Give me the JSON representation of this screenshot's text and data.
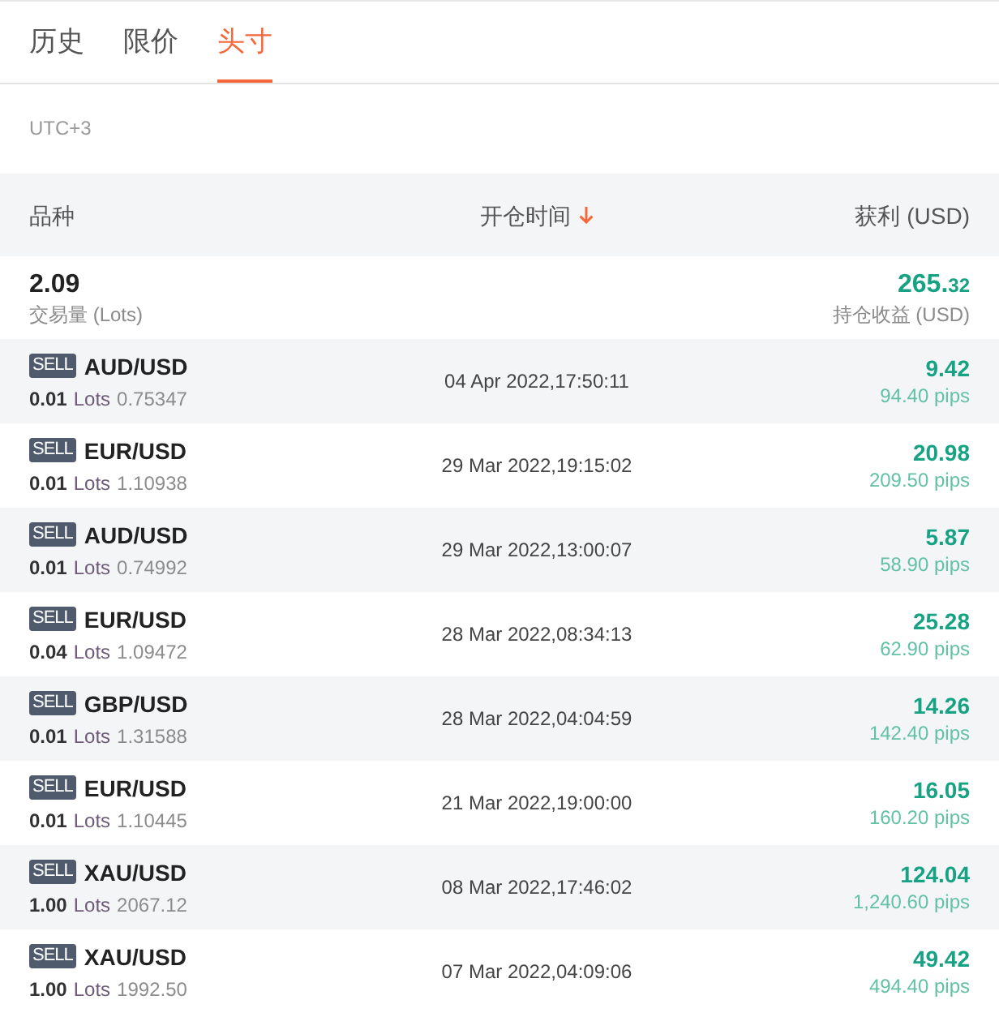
{
  "tabs": [
    {
      "label": "历史",
      "selected": false
    },
    {
      "label": "限价",
      "selected": false
    },
    {
      "label": "头寸",
      "selected": true
    }
  ],
  "timezone": "UTC+3",
  "table": {
    "columns": [
      {
        "label": "品种",
        "sorted": false
      },
      {
        "label": "开仓时间",
        "sorted": true
      },
      {
        "label": "获利 (USD)",
        "sorted": false
      }
    ],
    "summary": {
      "volume": "2.09",
      "volume_label": "交易量 (Lots)",
      "profit": "265.32",
      "profit_label": "持仓收益 (USD)"
    },
    "rows": [
      {
        "side": "SELL",
        "symbol": "AUD/USD",
        "lots": "0.01",
        "lots_unit": "Lots",
        "price": "0.75347",
        "open_time": "04 Apr 2022,17:50:11",
        "profit": "9.42",
        "pips": "94.40 pips"
      },
      {
        "side": "SELL",
        "symbol": "EUR/USD",
        "lots": "0.01",
        "lots_unit": "Lots",
        "price": "1.10938",
        "open_time": "29 Mar 2022,19:15:02",
        "profit": "20.98",
        "pips": "209.50 pips"
      },
      {
        "side": "SELL",
        "symbol": "AUD/USD",
        "lots": "0.01",
        "lots_unit": "Lots",
        "price": "0.74992",
        "open_time": "29 Mar 2022,13:00:07",
        "profit": "5.87",
        "pips": "58.90 pips"
      },
      {
        "side": "SELL",
        "symbol": "EUR/USD",
        "lots": "0.04",
        "lots_unit": "Lots",
        "price": "1.09472",
        "open_time": "28 Mar 2022,08:34:13",
        "profit": "25.28",
        "pips": "62.90 pips"
      },
      {
        "side": "SELL",
        "symbol": "GBP/USD",
        "lots": "0.01",
        "lots_unit": "Lots",
        "price": "1.31588",
        "open_time": "28 Mar 2022,04:04:59",
        "profit": "14.26",
        "pips": "142.40 pips"
      },
      {
        "side": "SELL",
        "symbol": "EUR/USD",
        "lots": "0.01",
        "lots_unit": "Lots",
        "price": "1.10445",
        "open_time": "21 Mar 2022,19:00:00",
        "profit": "16.05",
        "pips": "160.20 pips"
      },
      {
        "side": "SELL",
        "symbol": "XAU/USD",
        "lots": "1.00",
        "lots_unit": "Lots",
        "price": "2067.12",
        "open_time": "08 Mar 2022,17:46:02",
        "profit": "124.04",
        "pips": "1,240.60 pips"
      },
      {
        "side": "SELL",
        "symbol": "XAU/USD",
        "lots": "1.00",
        "lots_unit": "Lots",
        "price": "1992.50",
        "open_time": "07 Mar 2022,04:09:06",
        "profit": "49.42",
        "pips": "494.40 pips"
      }
    ]
  }
}
